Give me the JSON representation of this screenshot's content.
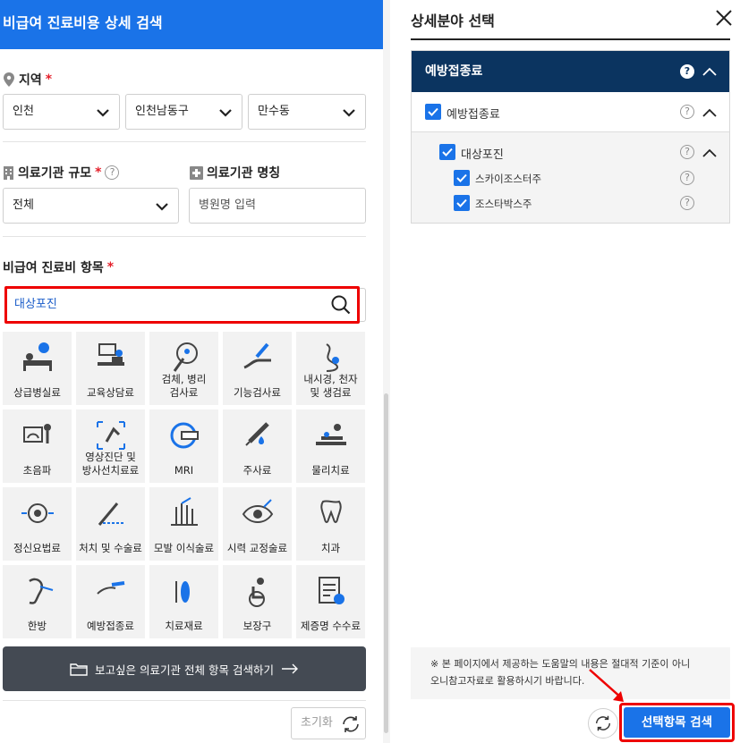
{
  "left": {
    "title": "비급여 진료비용 상세 검색",
    "region": {
      "label": "지역",
      "required": "*",
      "province": "인천",
      "district": "인천남동구",
      "dong": "만수동"
    },
    "scale": {
      "label": "의료기관 규모",
      "required": "*",
      "help": "?",
      "value": "전체"
    },
    "name": {
      "label": "의료기관 명칭",
      "placeholder": "병원명 입력"
    },
    "items": {
      "label": "비급여 진료비 항목",
      "required": "*",
      "search_value": "대상포진"
    },
    "categories": [
      {
        "l1": "상급병실료",
        "l2": "",
        "icon": "hospital-bed-icon"
      },
      {
        "l1": "교육상담료",
        "l2": "",
        "icon": "counseling-icon"
      },
      {
        "l1": "검체, 병리",
        "l2": "검사료",
        "icon": "pathology-icon"
      },
      {
        "l1": "기능검사료",
        "l2": "",
        "icon": "function-test-icon"
      },
      {
        "l1": "내시경, 천자",
        "l2": "및 생검료",
        "icon": "endoscope-icon"
      },
      {
        "l1": "초음파",
        "l2": "",
        "icon": "ultrasound-icon"
      },
      {
        "l1": "영상진단 및",
        "l2": "방사선치료료",
        "icon": "radiology-icon"
      },
      {
        "l1": "MRI",
        "l2": "",
        "icon": "mri-icon"
      },
      {
        "l1": "주사료",
        "l2": "",
        "icon": "injection-icon"
      },
      {
        "l1": "물리치료",
        "l2": "",
        "icon": "physical-therapy-icon"
      },
      {
        "l1": "정신요법료",
        "l2": "",
        "icon": "brain-icon"
      },
      {
        "l1": "처치 및 수술료",
        "l2": "",
        "icon": "surgery-icon"
      },
      {
        "l1": "모발 이식술료",
        "l2": "",
        "icon": "hair-transplant-icon"
      },
      {
        "l1": "시력 교정술료",
        "l2": "",
        "icon": "eye-icon"
      },
      {
        "l1": "치과",
        "l2": "",
        "icon": "tooth-icon"
      },
      {
        "l1": "한방",
        "l2": "",
        "icon": "acupuncture-icon"
      },
      {
        "l1": "예방접종료",
        "l2": "",
        "icon": "vaccine-icon"
      },
      {
        "l1": "치료재료",
        "l2": "",
        "icon": "medical-material-icon"
      },
      {
        "l1": "보장구",
        "l2": "",
        "icon": "wheelchair-icon"
      },
      {
        "l1": "제증명 수수료",
        "l2": "",
        "icon": "certificate-icon"
      }
    ],
    "all_search_button": "보고싶은 의료기관 전체 항목 검색하기",
    "reset_button": "초기화"
  },
  "right": {
    "title": "상세분야 선택",
    "tree_header": "예방접종료",
    "level1": "예방접종료",
    "level2": "대상포진",
    "level3": [
      "스카이조스터주",
      "조스타박스주"
    ],
    "help": "?",
    "notice_line1": "※ 본 페이지에서 제공하는 도움말의 내용은 절대적 기준이 아니",
    "notice_line2": "오니참고자료로 활용하시기 바랍니다.",
    "submit_button": "선택항목 검색"
  },
  "colors": {
    "primary": "#1a73e8",
    "navy": "#0b3460",
    "highlight": "#e00000",
    "dark_button": "#444a53"
  }
}
